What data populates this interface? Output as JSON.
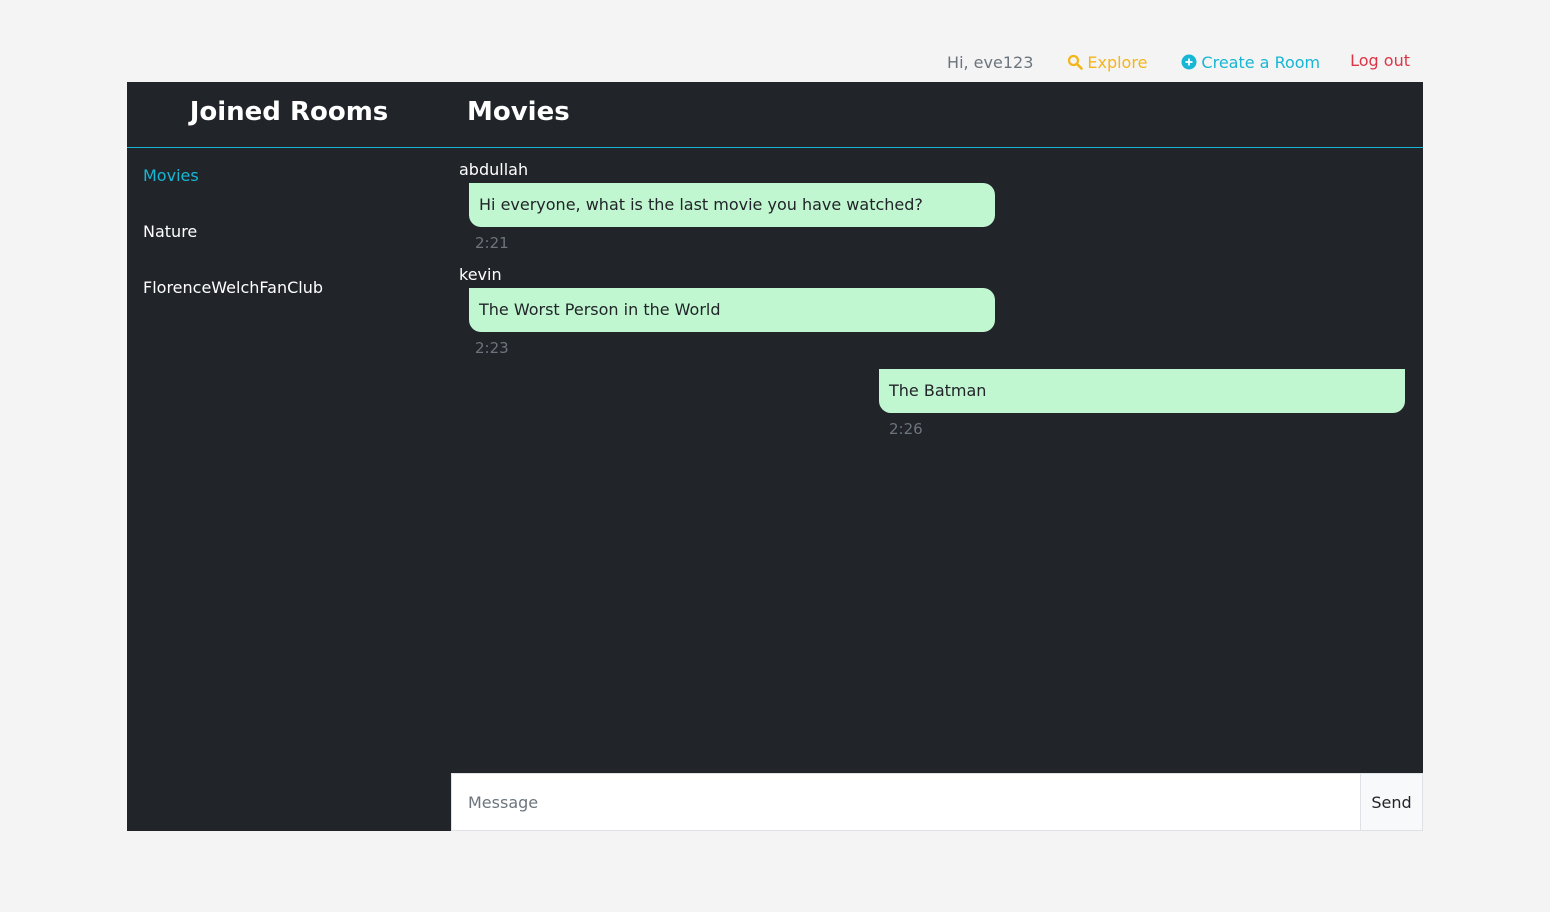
{
  "nav": {
    "greeting": "Hi, eve123",
    "explore_label": "Explore",
    "create_label": "Create a Room",
    "logout_label": "Log out"
  },
  "sidebar": {
    "title": "Joined Rooms",
    "rooms": [
      {
        "label": "Movies",
        "active": true
      },
      {
        "label": "Nature",
        "active": false
      },
      {
        "label": "FlorenceWelchFanClub",
        "active": false
      }
    ]
  },
  "room": {
    "title": "Movies",
    "messages": [
      {
        "author": "abdullah",
        "text": "Hi everyone, what is the last movie you have watched?",
        "time": "2:21",
        "self": false
      },
      {
        "author": "kevin",
        "text": "The Worst Person in the World",
        "time": "2:23",
        "self": false
      },
      {
        "author": "",
        "text": "The Batman",
        "time": "2:26",
        "self": true
      }
    ]
  },
  "composer": {
    "placeholder": "Message",
    "send_label": "Send"
  },
  "colors": {
    "accent": "#17b6d4",
    "explore": "#f3b519",
    "logout": "#dc3545",
    "panel": "#212429",
    "bubble": "#c1f7d0"
  }
}
